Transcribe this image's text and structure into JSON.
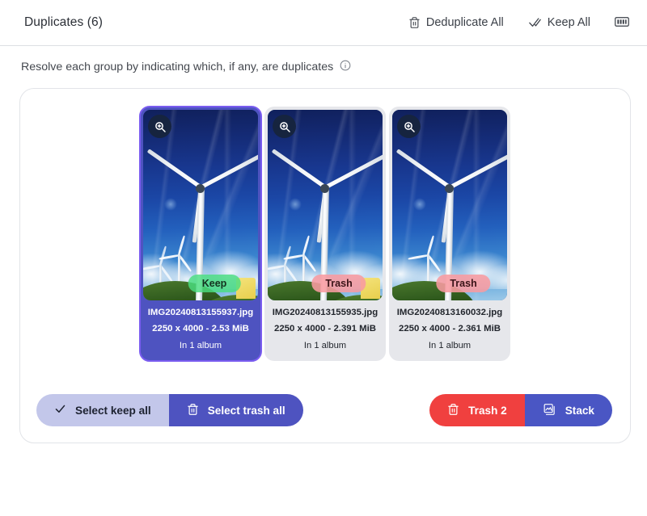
{
  "header": {
    "title": "Duplicates (6)",
    "actions": [
      {
        "label": "Deduplicate All",
        "icon": "trash-icon"
      },
      {
        "label": "Keep All",
        "icon": "double-check-icon"
      }
    ],
    "keyboard_icon": "keyboard-icon"
  },
  "subtitle": {
    "text": "Resolve each group by indicating which, if any, are duplicates",
    "icon": "info-icon"
  },
  "group": {
    "assets": [
      {
        "filename": "IMG20240813155937.jpg",
        "dimensions": "2250 x 4000 - 2.53 MiB",
        "album": "In 1 album",
        "status": "Keep",
        "state": "keep",
        "zoom_icon": "zoom-in-icon"
      },
      {
        "filename": "IMG20240813155935.jpg",
        "dimensions": "2250 x 4000 - 2.391 MiB",
        "album": "In 1 album",
        "status": "Trash",
        "state": "trash",
        "zoom_icon": "zoom-in-icon"
      },
      {
        "filename": "IMG20240813160032.jpg",
        "dimensions": "2250 x 4000 - 2.361 MiB",
        "album": "In 1 album",
        "status": "Trash",
        "state": "trash",
        "zoom_icon": "zoom-in-icon"
      }
    ],
    "footer": {
      "select_keep_all": "Select keep all",
      "select_trash_all": "Select trash all",
      "trash": "Trash 2",
      "stack": "Stack"
    }
  },
  "colors": {
    "keep_card": "#4e53c0",
    "trash_card": "#e6e7eb",
    "keep_pill": "#4ade80",
    "trash_pill": "#f89ba0",
    "trash_button": "#f0403f",
    "stack_button": "#4a56c4",
    "lavender_button": "#c3c7ea"
  }
}
